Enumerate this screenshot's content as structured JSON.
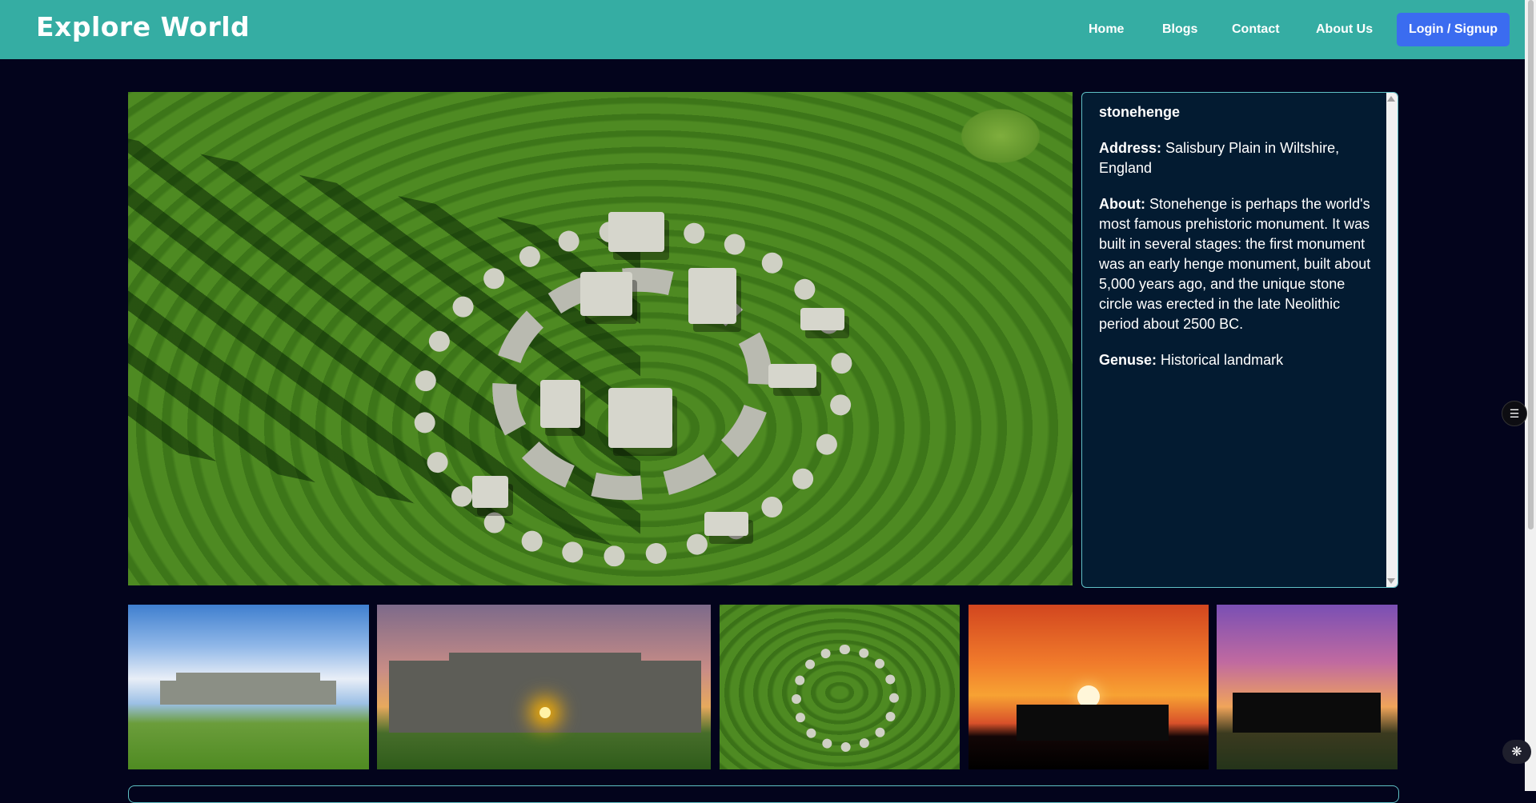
{
  "header": {
    "brand": "Explore World",
    "nav": [
      "Home",
      "Blogs",
      "Contact",
      "About Us"
    ],
    "login_label": "Login / Signup"
  },
  "place": {
    "title": "stonehenge",
    "address_label": "Address:",
    "address": "Salisbury Plain in Wiltshire, England",
    "about_label": "About:",
    "about": "Stonehenge is perhaps the world's most famous prehistoric monument. It was built in several stages: the first monument was an early henge monument, built about 5,000 years ago, and the unique stone circle was erected in the late Neolithic period about 2500 BC.",
    "genus_label": "Genuse:",
    "genus": "Historical landmark"
  },
  "colors": {
    "header_bg": "#35ada3",
    "page_bg": "#03041c",
    "panel_bg": "#031b31",
    "panel_border": "#5fc1c6",
    "login_bg": "#3b6cf0"
  },
  "icons": {
    "floating_tool": "list-settings-icon",
    "assistant": "brain-icon"
  }
}
